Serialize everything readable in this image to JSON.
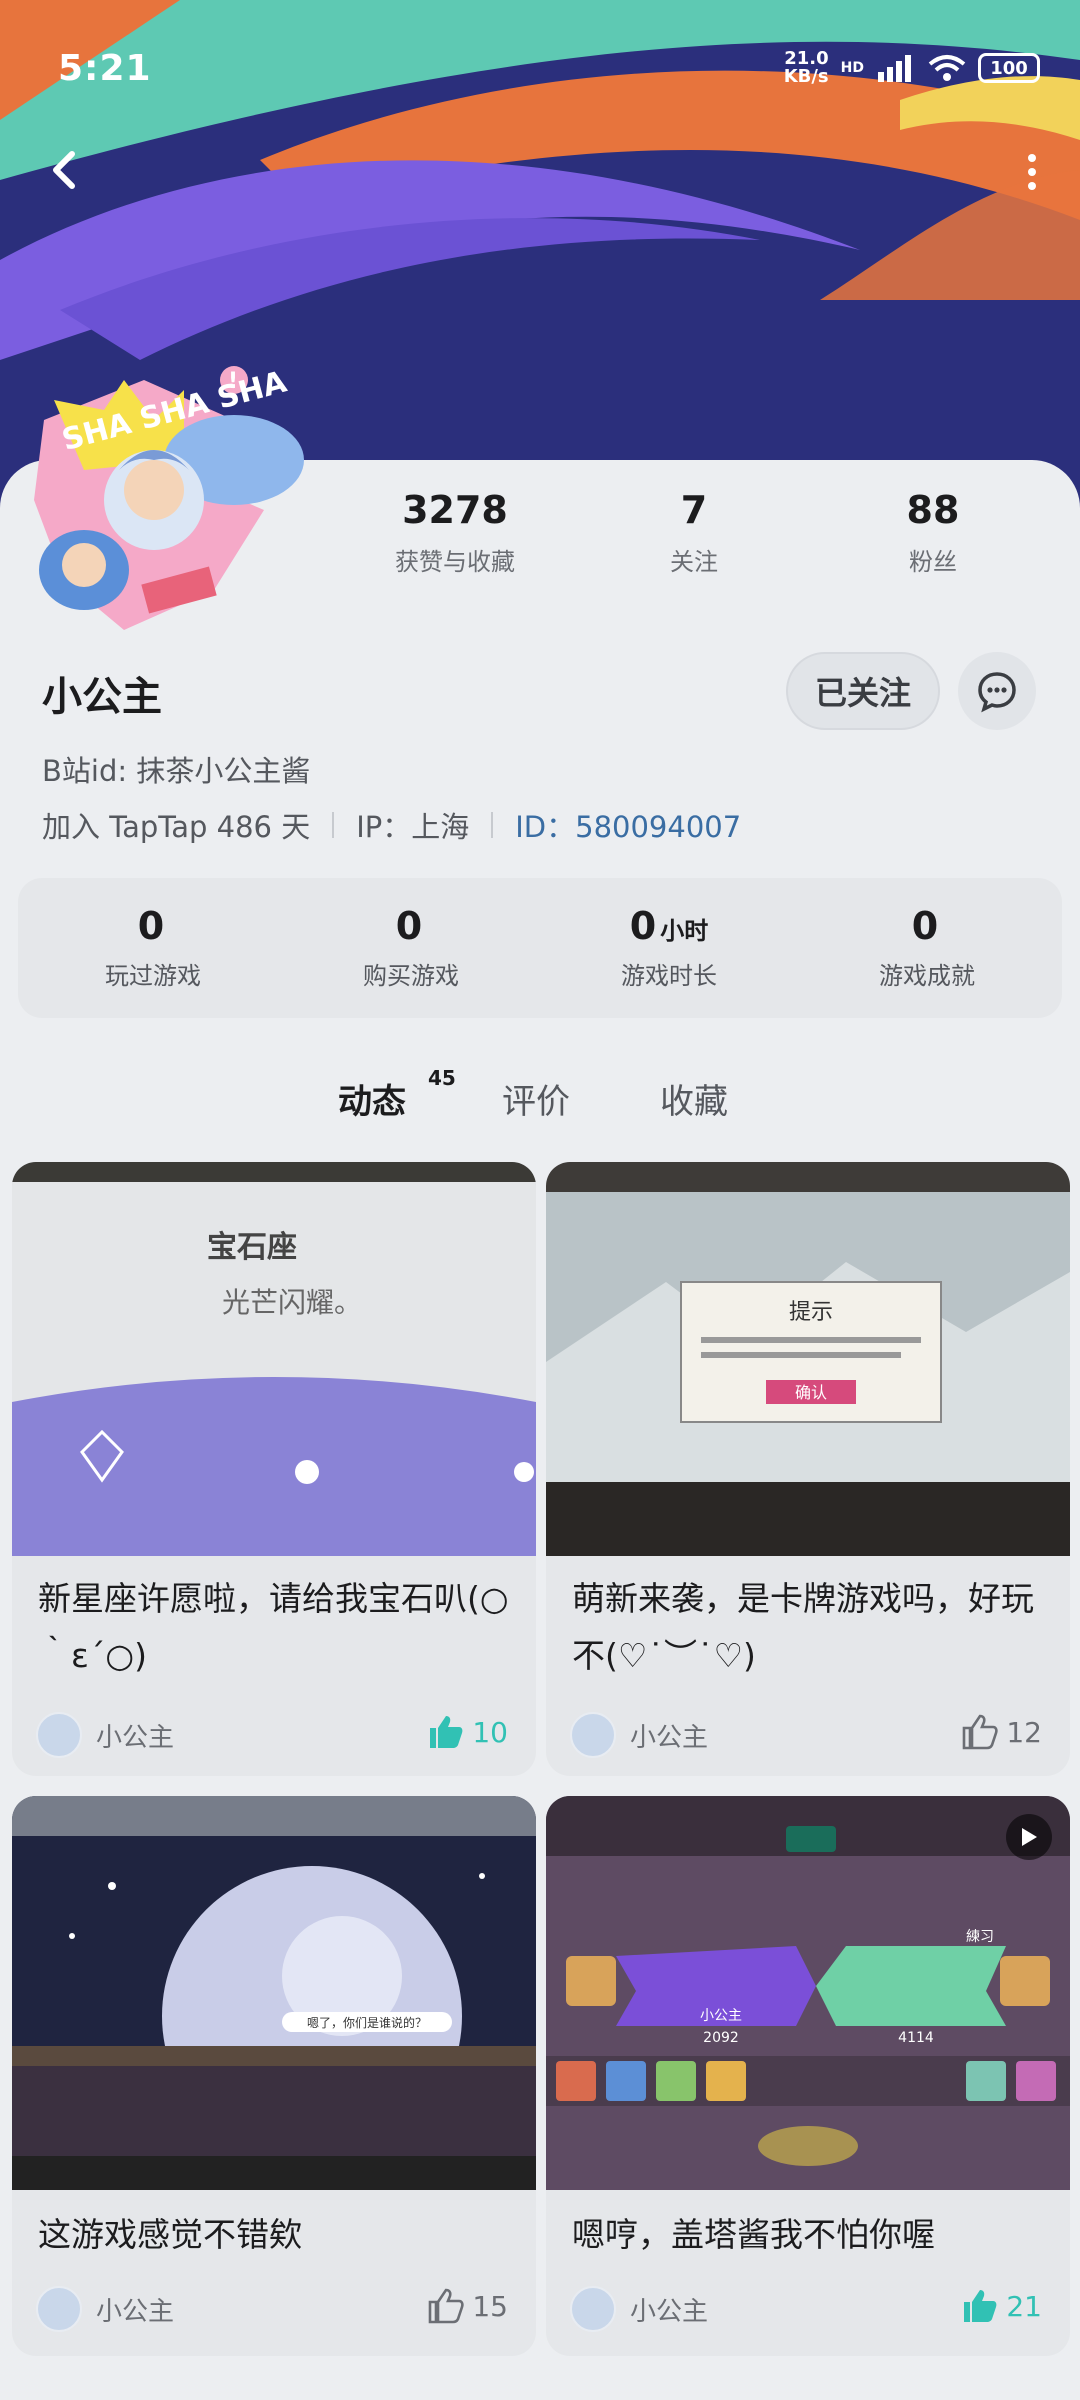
{
  "status_bar": {
    "time": "5:21",
    "net_speed_top": "21.0",
    "net_speed_bottom": "KB/s",
    "hd": "HD",
    "battery": "100"
  },
  "profile": {
    "avatar_text": "SHA SHA SHA",
    "name": "小公主",
    "follow_label": "已关注",
    "bili": "B站id: 抹茶小公主酱",
    "join": "加入 TapTap 486 天",
    "ip": "IP：上海",
    "id_label": "ID：580094007",
    "stats": [
      {
        "value": "3278",
        "label": "获赞与收藏"
      },
      {
        "value": "7",
        "label": "关注"
      },
      {
        "value": "88",
        "label": "粉丝"
      }
    ]
  },
  "game_stats": [
    {
      "value": "0",
      "unit": "",
      "label": "玩过游戏"
    },
    {
      "value": "0",
      "unit": "",
      "label": "购买游戏"
    },
    {
      "value": "0",
      "unit": "小时",
      "label": "游戏时长"
    },
    {
      "value": "0",
      "unit": "",
      "label": "游戏成就"
    }
  ],
  "tabs": [
    {
      "label": "动态",
      "count": "45"
    },
    {
      "label": "评价",
      "count": ""
    },
    {
      "label": "收藏",
      "count": ""
    }
  ],
  "posts": [
    {
      "title": "新星座许愿啦，请给我宝石叭(○｀ε´○)",
      "author": "小公主",
      "likes": "10",
      "liked": true,
      "image_texts": [
        "宝石座",
        "光芒闪耀。"
      ]
    },
    {
      "title": "萌新来袭，是卡牌游戏吗，好玩不(♡˙︶˙♡)",
      "author": "小公主",
      "likes": "12",
      "liked": false,
      "image_texts": [
        "提示",
        "确认"
      ]
    },
    {
      "title": "这游戏感觉不错欸",
      "author": "小公主",
      "likes": "15",
      "liked": false,
      "image_texts": [
        "嗯了，你们是谁说的？"
      ]
    },
    {
      "title": "嗯哼，盖塔酱我不怕你喔",
      "author": "小公主",
      "likes": "21",
      "liked": true,
      "image_texts": [
        "小公主",
        "2092",
        "4114",
        "練习"
      ]
    }
  ],
  "colors": {
    "accent": "#31c1b4",
    "id_blue": "#3a6da3",
    "banner_bg": "#2a2f7a"
  }
}
